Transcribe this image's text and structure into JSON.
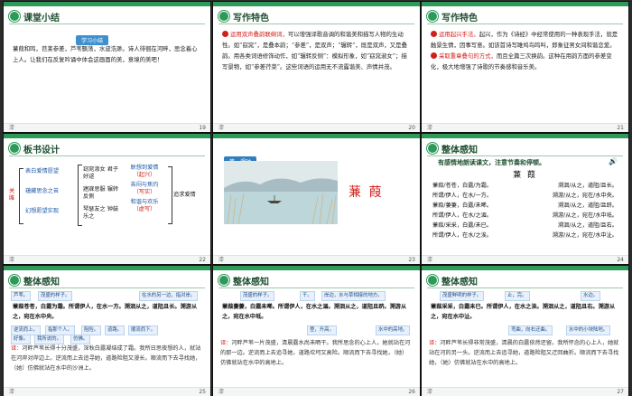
{
  "slides": [
    {
      "num": "19",
      "title": "课堂小结",
      "foot_left": "漆",
      "badge": "学习小结",
      "text": "蒹葭和鸣，苕莱参差，芦苇飘荡，水波浩渺。诗人徘徊在河畔，思念着心上人。让我们在反复吟诵中体会这画面的美，意境的美吧！"
    },
    {
      "num": "20",
      "title": "写作特色",
      "foot_left": "漆",
      "text_red": "运用双声叠韵联绵词，",
      "text": "可以增强译歌音调的和谐美和描写人物的生动性。如“窈窕”，是叠本韵；“参差”，是双声；“辗转”，既是双声，又是叠韵。用各类词语修饰动作，如“辗转反侧”：模拟形象，如“窈窕淑女”；描写景物，如“参差荇菜”。这些词语的运用无不流露谐美、声情并茂。"
    },
    {
      "num": "21",
      "title": "写作特色",
      "foot_left": "漆",
      "p1_red": "运用起兴手法。",
      "p1": "起兴，作为《诗经》中经常使用的一种表现手法，就是触景生情，因事写意。如该首诗写雎鸠鸟鸣叫，即象征男女间和谐恋爱。",
      "p2_red": "采取重章叠句的方式，",
      "p2": "而且全篇三次换韵。这种在用韵方面的参差变化，极大地增强了诗歌的节奏感和音乐美。"
    },
    {
      "num": "22",
      "title": "板书设计",
      "foot_left": "漆",
      "side": "关雎",
      "col1": [
        "表白爱情愿望",
        "蕴藏思念之苦",
        "幻想愿望实现"
      ],
      "col2": [
        "窈窕淑女 君子好逑",
        "寤寐思服 辗转反侧",
        "琴瑟友之 钟鼓乐之"
      ],
      "col3": [
        "联想到爱情",
        "（起兴）",
        "苦闷与焦灼",
        "（写实）",
        "和谐与欢乐",
        "（虚写）"
      ],
      "end": "追求爱情"
    },
    {
      "num": "23",
      "title": "",
      "foot_left": "漆",
      "badge": "第一课时",
      "poem_title": "蒹  葭"
    },
    {
      "num": "24",
      "title": "整体感知",
      "foot_left": "漆",
      "subtitle": "有感情地朗读课文，注意节奏和停顿。",
      "poem_title": "蒹  葭",
      "speaker_icon": "speaker-icon",
      "lines": [
        [
          "蒹葭/苍苍，白露/为霜。",
          "溯洄/从之，道阻/且长。"
        ],
        [
          "所谓/伊人，在水/一方。",
          "溯游/从之，宛在/水中央。"
        ],
        [
          "蒹葭/萋萋，白露/未晞。",
          "溯洄/从之，道阻/且跻。"
        ],
        [
          "所谓/伊人，在水/之湄。",
          "溯游/从之，宛在/水中坻。"
        ],
        [
          "蒹葭/采采，白露/未已。",
          "溯洄/从之，道阻/且右。"
        ],
        [
          "所谓/伊人，在水/之涘。",
          "溯游/从之，宛在/水中沚。"
        ]
      ]
    },
    {
      "num": "25",
      "title": "整体感知",
      "foot_left": "漆",
      "notes": [
        "芦苇。",
        "茂盛的样子。",
        "在水的另一边，指对岸。",
        "逆流而上。",
        "指那个人。",
        "阻险。",
        "道路。",
        "顺流而下。",
        "好像。",
        "我所说的。",
        "仿佛。"
      ],
      "poem": "蒹葭苍苍，白露为霜。所谓伊人，在水一方。溯洄从之，道阻且长。溯游从之，宛在水中央。",
      "trans_label": "译：",
      "trans": "河畔芦苇长得十分茂盛，深秋白露凝结成了霜。我所日思夜想的人，就站在河岸对岸边上。逆流而上去追寻她，道路险阻又漫长。顺流而下去寻找她，（她）仿佛就站在水中的沙洲上。"
    },
    {
      "num": "26",
      "title": "整体感知",
      "foot_left": "漆",
      "notes": [
        "茂盛的样子。",
        "干。",
        "岸边，水与草相接的地方。",
        "登，升高。",
        "水中的高地。"
      ],
      "poem": "蒹葭萋萋，白露未晞。所谓伊人，在水之湄。溯洄从之，道阻且跻。溯游从之，宛在水中坻。",
      "trans_label": "译：",
      "trans": "河畔芦苇一片茂盛，清晨露水尚未晒干。我所思念的心上人，她就站在河的那一边。逆流而上去追寻她，道路坎坷又高险。顺流而下去寻找她，（她）仿佛就站在水中的高地上。"
    },
    {
      "num": "27",
      "title": "整体感知",
      "foot_left": "漆",
      "notes": [
        "茂盛鲜明的样子。",
        "止，完。",
        "水边。",
        "弯曲，向右迂曲。",
        "水中的小块陆地。"
      ],
      "poem": "蒹葭采采，白露未已。所谓伊人，在水之涘。溯洄从之，道阻且右。溯游从之，宛在水中沚。",
      "trans_label": "译：",
      "trans": "河畔芦苇长得非常茂盛，清晨的白露依然还留。我所怀念的心上人，她就站在河的另一头。逆流而上去追寻她，道路险阻又迂回曲折。顺流而下去寻找她，（她）仿佛就站在水中的高地上。"
    }
  ]
}
